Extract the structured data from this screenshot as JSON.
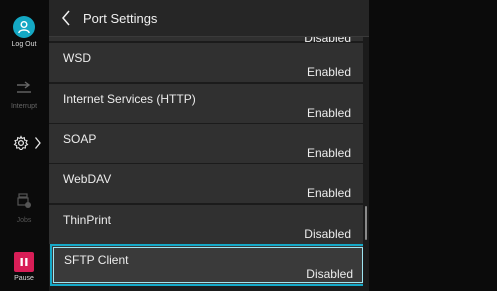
{
  "sidebar": {
    "logout_label": "Log Out",
    "interrupt_label": "Interrupt",
    "jobs_label": "Jobs",
    "pause_label": "Pause"
  },
  "header": {
    "title": "Port Settings"
  },
  "ports": [
    {
      "name": "",
      "value": "Disabled"
    },
    {
      "name": "WSD",
      "value": "Enabled"
    },
    {
      "name": "Internet Services (HTTP)",
      "value": "Enabled"
    },
    {
      "name": "SOAP",
      "value": "Enabled"
    },
    {
      "name": "WebDAV",
      "value": "Enabled"
    },
    {
      "name": "ThinPrint",
      "value": "Disabled"
    },
    {
      "name": "SFTP Client",
      "value": "Disabled"
    }
  ],
  "colors": {
    "accent": "#15a9c8",
    "pause": "#d81e57"
  }
}
